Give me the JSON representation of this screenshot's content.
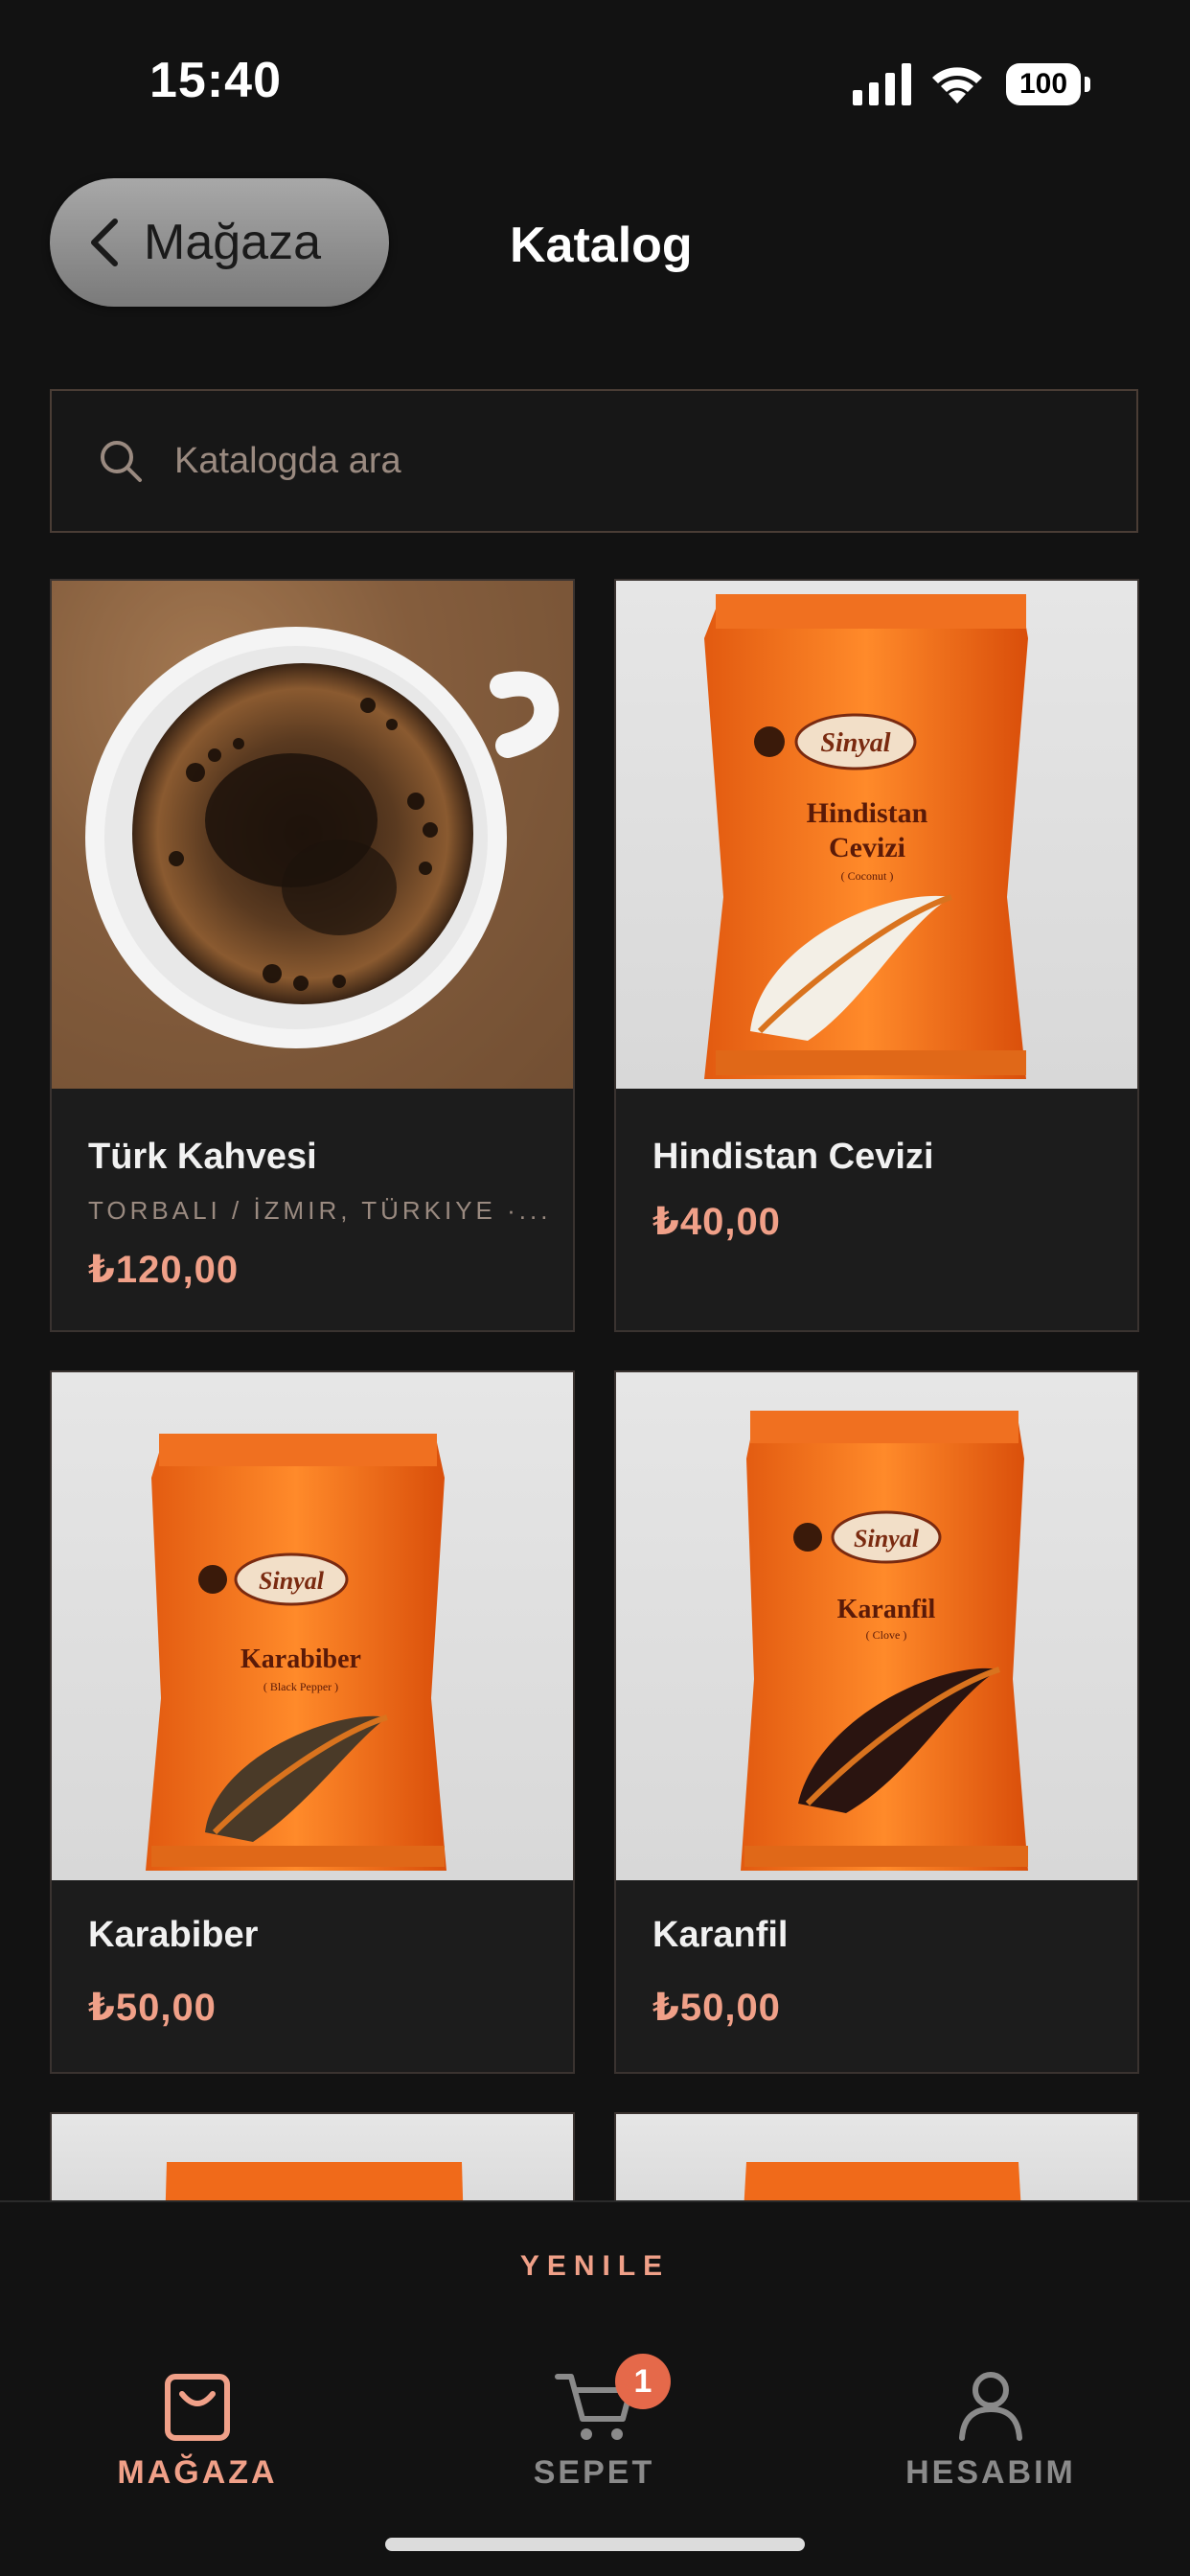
{
  "status_bar": {
    "time": "15:40",
    "battery": "100"
  },
  "nav": {
    "back_label": "Mağaza",
    "title": "Katalog"
  },
  "search": {
    "placeholder": "Katalogda ara"
  },
  "products": [
    {
      "name": "Türk Kahvesi",
      "origin": "TORBALI / İZMIR, TÜRKIYE ·...",
      "price": "₺120,00"
    },
    {
      "name": "Hindistan Cevizi",
      "price": "₺40,00",
      "brand": "Sinyal",
      "package_title": "Hindistan\nCevizi",
      "package_sub": "( Coconut )"
    },
    {
      "name": "Karabiber",
      "price": "₺50,00",
      "brand": "Sinyal",
      "package_title": "Karabiber",
      "package_sub": "( Black Pepper )"
    },
    {
      "name": "Karanfil",
      "price": "₺50,00",
      "brand": "Sinyal",
      "package_title": "Karanfil",
      "package_sub": "( Clove )"
    }
  ],
  "refresh": {
    "label": "YENILE"
  },
  "tabs": [
    {
      "label": "MAĞAZA",
      "icon": "shopping-bag-icon",
      "active": true
    },
    {
      "label": "SEPET",
      "icon": "cart-icon",
      "badge": "1"
    },
    {
      "label": "HESABIM",
      "icon": "user-icon"
    }
  ],
  "colors": {
    "accent": "#f0a088",
    "badge": "#e5694a",
    "background": "#121212",
    "card": "#1c1c1c"
  }
}
